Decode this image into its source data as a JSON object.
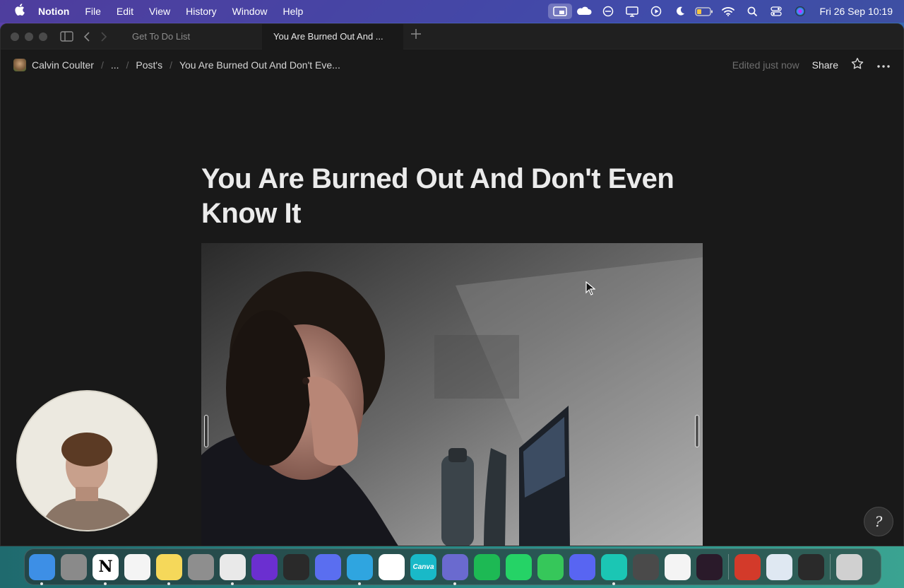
{
  "menubar": {
    "app_name": "Notion",
    "menus": [
      "File",
      "Edit",
      "View",
      "History",
      "Window",
      "Help"
    ],
    "status_icons": [
      "screen-mirror-icon",
      "cloud-icon",
      "focus-icon",
      "display-icon",
      "play-icon",
      "moon-icon",
      "battery-icon",
      "wifi-icon",
      "search-icon",
      "control-center-icon",
      "siri-icon"
    ],
    "clock": "Fri 26 Sep  10:19"
  },
  "window": {
    "tabs": [
      {
        "label": "Get To Do List",
        "active": false
      },
      {
        "label": "You Are Burned Out And ...",
        "active": true
      }
    ]
  },
  "breadcrumb": {
    "items": [
      "Calvin Coulter",
      "...",
      "Post's",
      "You Are Burned Out And Don't Eve..."
    ]
  },
  "topbar": {
    "edited": "Edited just now",
    "share": "Share"
  },
  "page": {
    "title_line1": "You Are Burned Out And Don't Even",
    "title_line2": "Know It"
  },
  "help": {
    "glyph": "?"
  },
  "dock": {
    "apps": [
      {
        "name": "finder",
        "color": "#3d8fe6",
        "glyph": "",
        "running": true
      },
      {
        "name": "launchpad",
        "color": "#8a8a8a",
        "glyph": "",
        "running": false
      },
      {
        "name": "notion",
        "color": "#ffffff",
        "glyph": "N",
        "running": true
      },
      {
        "name": "reminders",
        "color": "#f4f4f4",
        "glyph": "",
        "running": false
      },
      {
        "name": "notes",
        "color": "#f5d85a",
        "glyph": "",
        "running": true
      },
      {
        "name": "system-settings",
        "color": "#8e8e8e",
        "glyph": "",
        "running": false
      },
      {
        "name": "chrome",
        "color": "#e9e9e9",
        "glyph": "",
        "running": true
      },
      {
        "name": "arc",
        "color": "#6b2fd0",
        "glyph": "",
        "running": false
      },
      {
        "name": "audio-recorder",
        "color": "#2a2a2a",
        "glyph": "",
        "running": false
      },
      {
        "name": "perplexity",
        "color": "#5a6ef0",
        "glyph": "",
        "running": false
      },
      {
        "name": "telegram",
        "color": "#2fa5e0",
        "glyph": "",
        "running": true
      },
      {
        "name": "capcut",
        "color": "#ffffff",
        "glyph": "",
        "running": false
      },
      {
        "name": "canva",
        "color": "#19b9c8",
        "glyph": "Canva",
        "running": false
      },
      {
        "name": "screen-recorder",
        "color": "#6a6acf",
        "glyph": "",
        "running": true
      },
      {
        "name": "spotify",
        "color": "#1db954",
        "glyph": "",
        "running": false
      },
      {
        "name": "whatsapp",
        "color": "#25d366",
        "glyph": "",
        "running": false
      },
      {
        "name": "messages",
        "color": "#36c75a",
        "glyph": "",
        "running": false
      },
      {
        "name": "discord",
        "color": "#5865f2",
        "glyph": "",
        "running": false
      },
      {
        "name": "surfshark",
        "color": "#1bc6b4",
        "glyph": "",
        "running": true
      },
      {
        "name": "cloud-app",
        "color": "#4a4a4a",
        "glyph": "",
        "running": false
      },
      {
        "name": "photos",
        "color": "#f4f4f4",
        "glyph": "",
        "running": false
      },
      {
        "name": "mirror-app",
        "color": "#2a1a2a",
        "glyph": "",
        "running": false
      },
      {
        "name": "quill-app",
        "color": "#d33a2a",
        "glyph": "",
        "running": false
      },
      {
        "name": "preview",
        "color": "#dfe8f2",
        "glyph": "",
        "running": false
      },
      {
        "name": "quicktime",
        "color": "#2a2a2a",
        "glyph": "",
        "running": false
      },
      {
        "name": "trash",
        "color": "#d0d0d0",
        "glyph": "",
        "running": false
      }
    ]
  }
}
